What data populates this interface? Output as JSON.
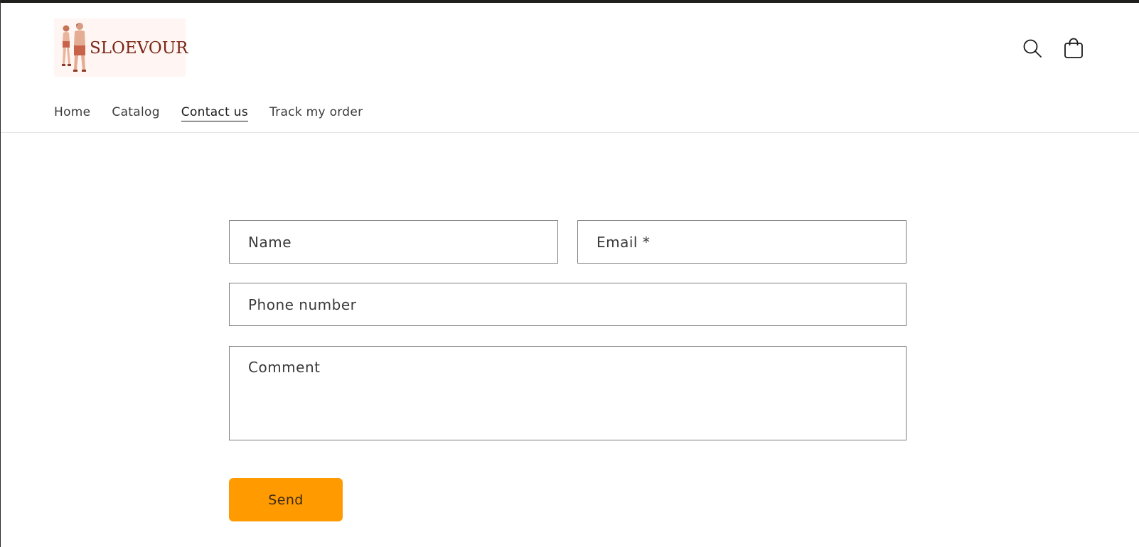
{
  "brand": {
    "logo_text": "SLOEVOUR",
    "logo_color": "#7a2616",
    "logo_background": "#fff6f3"
  },
  "header": {
    "icons": [
      "search-icon",
      "cart-icon"
    ]
  },
  "nav": {
    "items": [
      {
        "label": "Home",
        "active": false
      },
      {
        "label": "Catalog",
        "active": false
      },
      {
        "label": "Contact us",
        "active": true
      },
      {
        "label": "Track my order",
        "active": false
      }
    ]
  },
  "form": {
    "name_placeholder": "Name",
    "email_placeholder": "Email *",
    "phone_placeholder": "Phone number",
    "comment_placeholder": "Comment",
    "name_value": "",
    "email_value": "",
    "phone_value": "",
    "comment_value": "",
    "send_label": "Send"
  },
  "colors": {
    "accent": "#ff9b00",
    "topbar": "#1f1f1c",
    "text": "#3a3a3a",
    "border": "#7d7d7d"
  }
}
